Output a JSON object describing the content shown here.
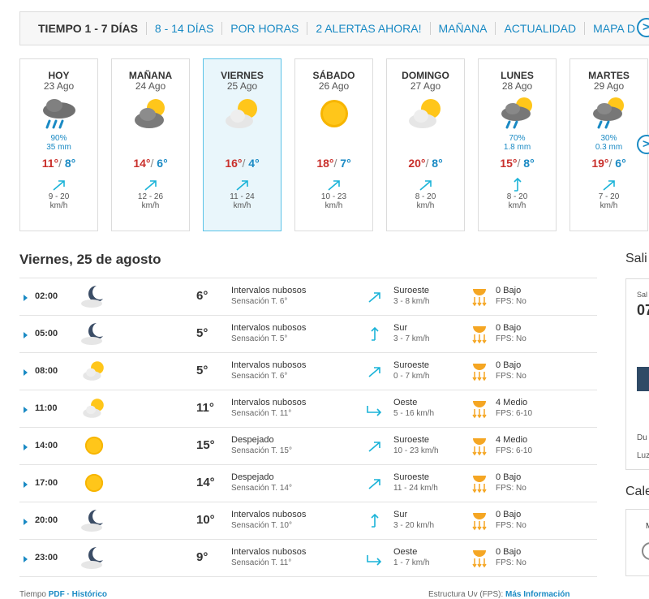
{
  "tabs": [
    {
      "label": "TIEMPO 1 - 7 DÍAS",
      "active": true
    },
    {
      "label": "8 - 14 DÍAS"
    },
    {
      "label": "POR HORAS"
    },
    {
      "label": "2 ALERTAS AHORA!"
    },
    {
      "label": "MAÑANA"
    },
    {
      "label": "ACTUALIDAD"
    },
    {
      "label": "MAPA D"
    }
  ],
  "days": [
    {
      "name": "HOY",
      "date": "23 Ago",
      "icon": "rain-cloud-icon",
      "prob": "90%",
      "mm": "35 mm",
      "max": "11°",
      "min": "8°",
      "wind": "9 - 20",
      "unit": "km/h",
      "dir": "sw"
    },
    {
      "name": "MAÑANA",
      "date": "24 Ago",
      "icon": "partly-cloudy-dark-icon",
      "prob": "",
      "mm": "",
      "max": "14°",
      "min": "6°",
      "wind": "12 - 26",
      "unit": "km/h",
      "dir": "sw"
    },
    {
      "name": "VIERNES",
      "date": "25 Ago",
      "icon": "partly-cloudy-icon",
      "prob": "",
      "mm": "",
      "max": "16°",
      "min": "4°",
      "wind": "11 - 24",
      "unit": "km/h",
      "dir": "sw",
      "selected": true
    },
    {
      "name": "SÁBADO",
      "date": "26 Ago",
      "icon": "sun-icon",
      "prob": "",
      "mm": "",
      "max": "18°",
      "min": "7°",
      "wind": "10 - 23",
      "unit": "km/h",
      "dir": "sw"
    },
    {
      "name": "DOMINGO",
      "date": "27 Ago",
      "icon": "partly-cloudy-icon",
      "prob": "",
      "mm": "",
      "max": "20°",
      "min": "8°",
      "wind": "8 - 20",
      "unit": "km/h",
      "dir": "sw"
    },
    {
      "name": "LUNES",
      "date": "28 Ago",
      "icon": "rain-sun-cloud-icon",
      "prob": "70%",
      "mm": "1.8 mm",
      "max": "15°",
      "min": "8°",
      "wind": "8 - 20",
      "unit": "km/h",
      "dir": "s"
    },
    {
      "name": "MARTES",
      "date": "29 Ago",
      "icon": "rain-sun-cloud-icon",
      "prob": "30%",
      "mm": "0.3 mm",
      "max": "19°",
      "min": "6°",
      "wind": "7 - 20",
      "unit": "km/h",
      "dir": "sw"
    }
  ],
  "detail_title": "Viernes, 25 de agosto",
  "hours": [
    {
      "time": "02:00",
      "icon": "moon-cloud-icon",
      "temp": "6°",
      "desc": "Intervalos nubosos",
      "feel": "Sensación T. 6°",
      "wdir": "Suroeste",
      "wspeed": "3 - 8 km/h",
      "arrow": "sw",
      "uv": "0 Bajo",
      "fps": "FPS: No"
    },
    {
      "time": "05:00",
      "icon": "moon-cloud-icon",
      "temp": "5°",
      "desc": "Intervalos nubosos",
      "feel": "Sensación T. 5°",
      "wdir": "Sur",
      "wspeed": "3 - 7 km/h",
      "arrow": "s",
      "uv": "0 Bajo",
      "fps": "FPS: No"
    },
    {
      "time": "08:00",
      "icon": "partly-cloudy-icon",
      "temp": "5°",
      "desc": "Intervalos nubosos",
      "feel": "Sensación T. 6°",
      "wdir": "Suroeste",
      "wspeed": "0 - 7 km/h",
      "arrow": "sw",
      "uv": "0 Bajo",
      "fps": "FPS: No"
    },
    {
      "time": "11:00",
      "icon": "partly-cloudy-icon",
      "temp": "11°",
      "desc": "Intervalos nubosos",
      "feel": "Sensación T. 11°",
      "wdir": "Oeste",
      "wspeed": "5 - 16 km/h",
      "arrow": "w",
      "uv": "4 Medio",
      "fps": "FPS: 6-10"
    },
    {
      "time": "14:00",
      "icon": "sun-icon",
      "temp": "15°",
      "desc": "Despejado",
      "feel": "Sensación T. 15°",
      "wdir": "Suroeste",
      "wspeed": "10 - 23 km/h",
      "arrow": "sw",
      "uv": "4 Medio",
      "fps": "FPS: 6-10"
    },
    {
      "time": "17:00",
      "icon": "sun-icon",
      "temp": "14°",
      "desc": "Despejado",
      "feel": "Sensación T. 14°",
      "wdir": "Suroeste",
      "wspeed": "11 - 24 km/h",
      "arrow": "sw",
      "uv": "0 Bajo",
      "fps": "FPS: No"
    },
    {
      "time": "20:00",
      "icon": "moon-cloud-icon",
      "temp": "10°",
      "desc": "Intervalos nubosos",
      "feel": "Sensación T. 10°",
      "wdir": "Sur",
      "wspeed": "3 - 20 km/h",
      "arrow": "s",
      "uv": "0 Bajo",
      "fps": "FPS: No"
    },
    {
      "time": "23:00",
      "icon": "moon-cloud-icon",
      "temp": "9°",
      "desc": "Intervalos nubosos",
      "feel": "Sensación T. 11°",
      "wdir": "Oeste",
      "wspeed": "1 - 7 km/h",
      "arrow": "w",
      "uv": "0 Bajo",
      "fps": "FPS: No"
    }
  ],
  "side": {
    "title": "Sali",
    "box_label": "Sal",
    "box_time": "07",
    "du": "Du",
    "luz": "Luz",
    "title2": "Cale",
    "m": "M"
  },
  "footer": {
    "left_prefix": "Tiempo ",
    "left_link": "PDF · Histórico",
    "right_prefix": "Estructura Uv (FPS): ",
    "right_link": "Más Información"
  },
  "colors": {
    "accent": "#1a8ac4",
    "max": "#c9302c",
    "min": "#1a8ac4",
    "selected_bg": "#e9f6fb"
  }
}
